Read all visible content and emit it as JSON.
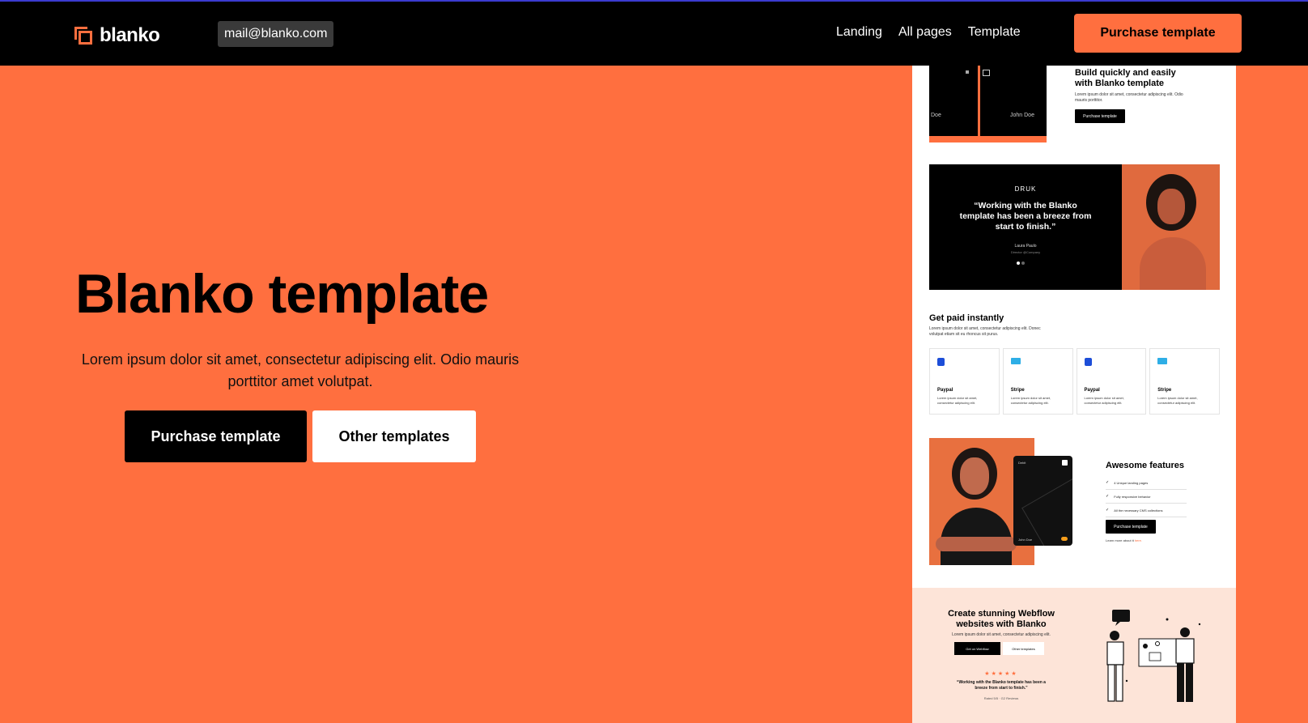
{
  "header": {
    "logo_text": "blanko",
    "email": "mail@blanko.com",
    "nav": [
      "Landing",
      "All pages",
      "Template"
    ],
    "cta": "Purchase template"
  },
  "hero": {
    "title": "Blanko template",
    "description": "Lorem ipsum dolor sit amet, consectetur adipiscing elit. Odio mauris porttitor amet volutpat.",
    "primary_button": "Purchase template",
    "secondary_button": "Other templates"
  },
  "preview": {
    "hero_img": {
      "name_left": "Doe",
      "name_right": "John Doe"
    },
    "build": {
      "title": "Build quickly and easily with Blanko template",
      "text": "Lorem ipsum dolor sit amet, consectetur adipiscing elit. Odio mauris porttitor.",
      "button": "Purchase template"
    },
    "testimonial": {
      "brand": "DRUK",
      "quote": "“Working with the Blanko template has been a breeze from start to finish.”",
      "name": "Laura Paulo",
      "role": "Director @Company"
    },
    "paid": {
      "title": "Get paid instantly",
      "text": "Lorem ipsum dolor sit amet, consectetur adipiscing elit. Donec volutpat etiam sit eu rhoncus sit purus.",
      "cards": [
        {
          "name": "Paypal",
          "icon": "paypal-icon",
          "text": "Lorem ipsum dolor sit amet, consectetur adipiscing elit."
        },
        {
          "name": "Stripe",
          "icon": "stripe-icon",
          "text": "Lorem ipsum dolor sit amet, consectetur adipiscing elit."
        },
        {
          "name": "Paypal",
          "icon": "paypal-icon",
          "text": "Lorem ipsum dolor sit amet, consectetur adipiscing elit."
        },
        {
          "name": "Stripe",
          "icon": "stripe-icon",
          "text": "Lorem ipsum dolor sit amet, consectetur adipiscing elit."
        }
      ]
    },
    "card_widget": {
      "label": "Debit",
      "name": "John Doe"
    },
    "features": {
      "title": "Awesome features",
      "items": [
        "4 Unique landing pages",
        "Fully responsive behavior",
        "All the necessary CMS collections"
      ],
      "button": "Purchase template",
      "link_prefix": "Learn more about it ",
      "link_text": "here."
    },
    "cta": {
      "title": "Create stunning Webflow websites with Blanko",
      "subtitle": "Lorem ipsum dolor sit amet, consectetur adipiscing elit.",
      "button_primary": "Get on Webflow",
      "button_secondary": "Other templates",
      "stars": "★★★★★",
      "quote": "“Working with the Blanko template has been a breeze from start to finish.”",
      "rated": "Rated 5/5 · G2 Reviews"
    }
  },
  "colors": {
    "accent": "#ff6f3f",
    "dark": "#000000",
    "light": "#ffffff",
    "blush": "#fde4d8"
  }
}
